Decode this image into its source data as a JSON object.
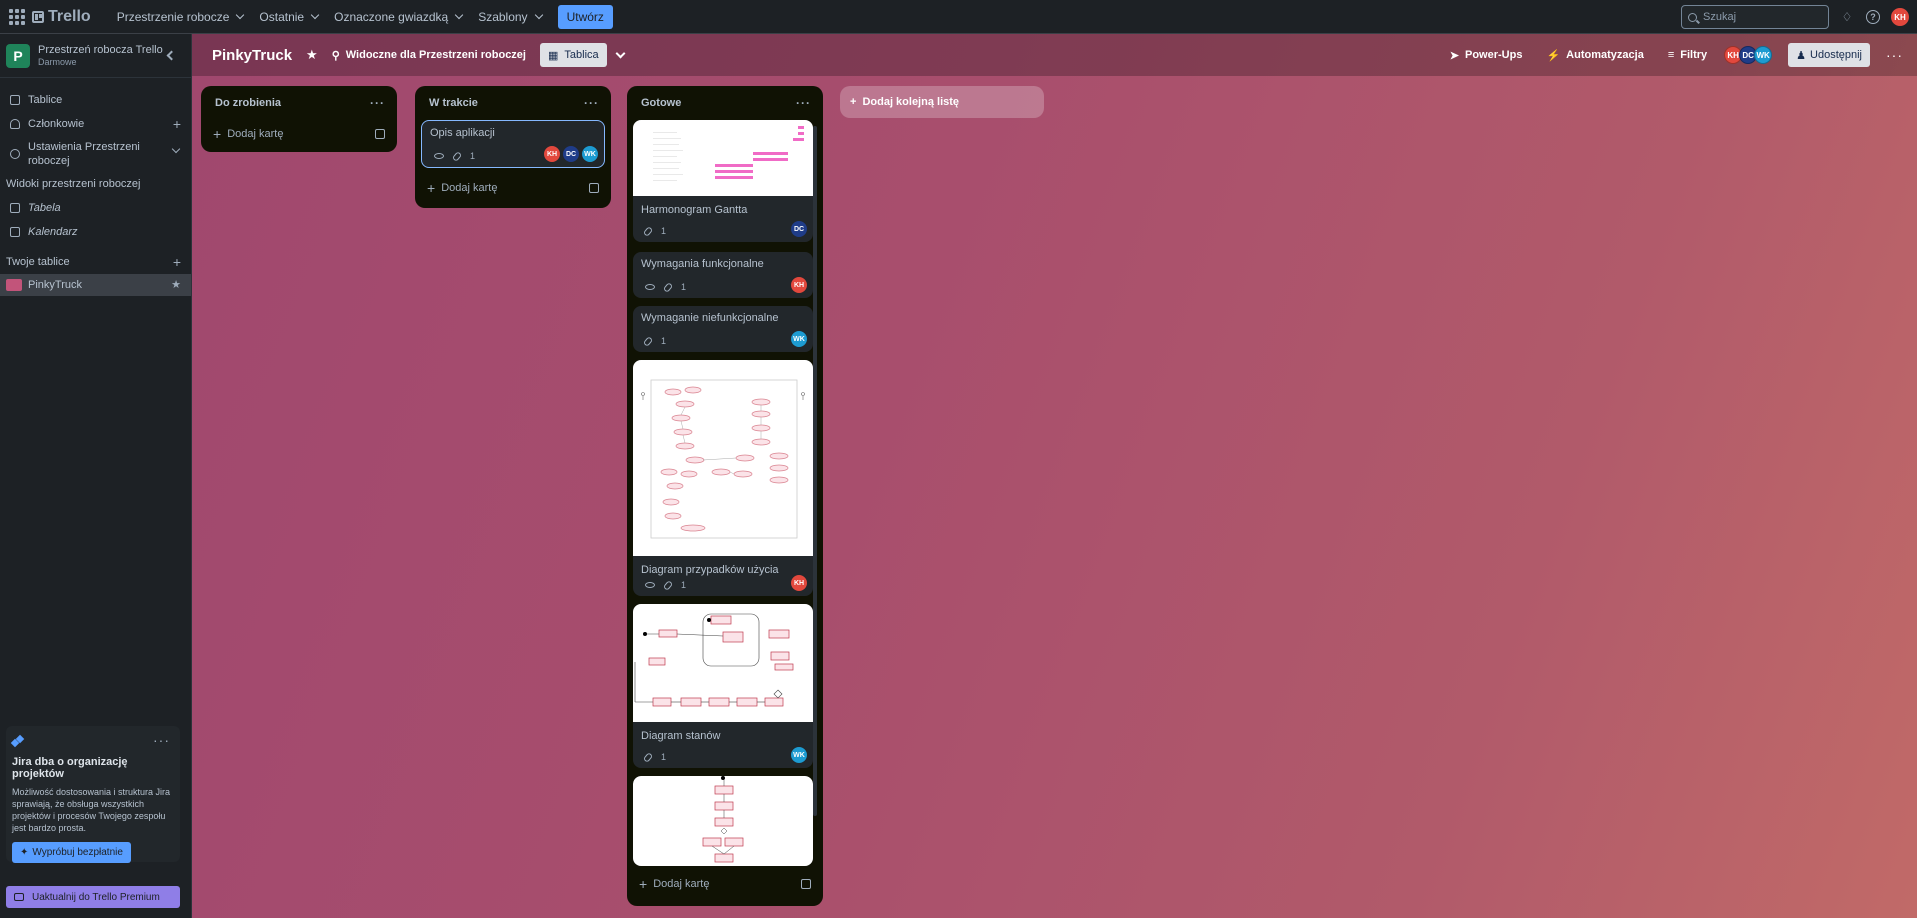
{
  "topnav": {
    "logo": "Trello",
    "menus": [
      "Przestrzenie robocze",
      "Ostatnie",
      "Oznaczone gwiazdką",
      "Szablony"
    ],
    "create": "Utwórz",
    "search_placeholder": "Szukaj",
    "user_initials": "KH"
  },
  "sidebar": {
    "workspace_initial": "P",
    "workspace_name": "Przestrzeń robocza Trello",
    "workspace_plan": "Darmowe",
    "items": [
      {
        "label": "Tablice"
      },
      {
        "label": "Członkowie"
      },
      {
        "label": "Ustawienia Przestrzeni roboczej"
      }
    ],
    "views_heading": "Widoki przestrzeni roboczej",
    "views": [
      {
        "label": "Tabela"
      },
      {
        "label": "Kalendarz"
      }
    ],
    "boards_heading": "Twoje tablice",
    "boards": [
      {
        "label": "PinkyTruck"
      }
    ],
    "jira": {
      "title": "Jira dba o organizację projektów",
      "text": "Możliwość dostosowania i struktura Jira sprawiają, że obsługa wszystkich projektów i procesów Twojego zespołu jest bardzo prosta.",
      "button": "Wypróbuj bezpłatnie"
    },
    "upgrade": "Uaktualnij do Trello Premium"
  },
  "board": {
    "title": "PinkyTruck",
    "visibility": "Widoczne dla Przestrzeni roboczej",
    "view": "Tablica",
    "powerups": "Power-Ups",
    "automation": "Automatyzacja",
    "filters": "Filtry",
    "share": "Udostępnij",
    "members": [
      {
        "initials": "KH",
        "color": "#e2483d"
      },
      {
        "initials": "DC",
        "color": "#1f3c88"
      },
      {
        "initials": "WK",
        "color": "#1d9bd1"
      }
    ]
  },
  "lists": [
    {
      "title": "Do zrobienia",
      "add": "Dodaj kartę",
      "cards": []
    },
    {
      "title": "W trakcie",
      "add": "Dodaj kartę",
      "cards": [
        {
          "title": "Opis aplikacji",
          "watch": true,
          "attachments": "1",
          "members": [
            "KH",
            "DC",
            "WK"
          ]
        }
      ]
    },
    {
      "title": "Gotowe",
      "add": "Dodaj kartę",
      "cards": [
        {
          "title": "Harmonogram Gantta",
          "attachments": "1",
          "members": [
            "DC"
          ]
        },
        {
          "title": "Wymagania funkcjonalne",
          "watch": true,
          "attachments": "1",
          "members": [
            "KH"
          ]
        },
        {
          "title": "Wymaganie niefunkcjonalne",
          "attachments": "1",
          "members": [
            "WK"
          ]
        },
        {
          "title": "Diagram przypadków użycia",
          "watch": true,
          "attachments": "1",
          "members": [
            "KH"
          ]
        },
        {
          "title": "Diagram stanów",
          "attachments": "1",
          "members": [
            "WK"
          ]
        }
      ]
    }
  ],
  "add_list": "Dodaj kolejną listę"
}
